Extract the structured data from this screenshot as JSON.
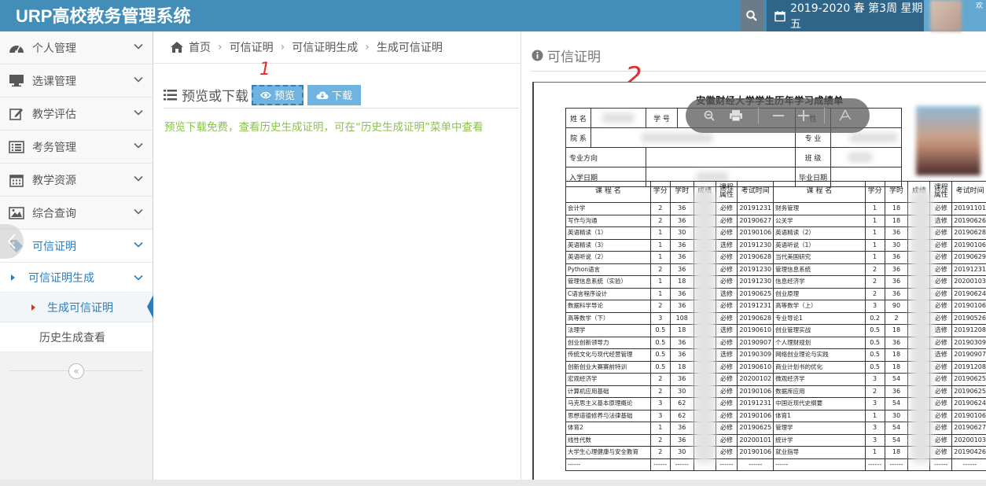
{
  "app": {
    "title": "URP高校教务管理系统",
    "term": "2019-2020 春 第3周 星期五",
    "user_tag": "欢"
  },
  "sidebar": {
    "items": [
      {
        "label": "个人管理",
        "icon": "dashboard-icon"
      },
      {
        "label": "选课管理",
        "icon": "desktop-icon"
      },
      {
        "label": "教学评估",
        "icon": "edit-icon"
      },
      {
        "label": "考务管理",
        "icon": "list-icon"
      },
      {
        "label": "教学资源",
        "icon": "calendar-icon"
      },
      {
        "label": "综合查询",
        "icon": "picture-icon"
      },
      {
        "label": "可信证明",
        "icon": "tag-icon"
      }
    ],
    "sub": {
      "group": "可信证明生成",
      "active": "生成可信证明",
      "history": "历史生成查看"
    }
  },
  "breadcrumb": [
    "首页",
    "可信证明",
    "可信证明生成",
    "生成可信证明"
  ],
  "left_pane": {
    "title": "预览或下载",
    "preview_label": "预览",
    "download_label": "下载",
    "notice": "预览下载免费，查看历史生成证明，可在“历史生成证明”菜单中查看",
    "annotation": "1"
  },
  "right_pane": {
    "heading": "可信证明",
    "annotation": "2"
  },
  "document": {
    "title": "安徽财经大学学生历年学习成绩单",
    "info": {
      "name": "姓 名",
      "student_no": "学 号",
      "college": "院 系",
      "major": "专 业",
      "direction": "专业方向",
      "class": "班 级",
      "enroll": "入学日期",
      "graduate": "毕业日期",
      "gender": "性"
    },
    "headers": [
      "课 程 名",
      "学分",
      "学时",
      "成绩",
      "课程属性",
      "考试时间",
      "课 程 名",
      "学分",
      "学时",
      "成绩",
      "课程属性",
      "考试时间"
    ],
    "rows": [
      [
        "会计学",
        "2",
        "36",
        "必修",
        "20191231",
        "财务管理",
        "1",
        "18",
        "必修",
        "20191101"
      ],
      [
        "写作与沟通",
        "2",
        "36",
        "必修",
        "20190627",
        "公关学",
        "1",
        "18",
        "选修",
        "20190626"
      ],
      [
        "英语精读（1）",
        "1",
        "30",
        "必修",
        "20190106",
        "英语精读（2）",
        "1",
        "36",
        "必修",
        "20190628"
      ],
      [
        "英语精读（3）",
        "1",
        "36",
        "选修",
        "20191230",
        "英语听说（1）",
        "1",
        "30",
        "必修",
        "20190106"
      ],
      [
        "英语听说（2）",
        "1",
        "36",
        "必修",
        "20190628",
        "当代美国研究",
        "1",
        "36",
        "必修",
        "20190629"
      ],
      [
        "Python语言",
        "2",
        "36",
        "必修",
        "20191230",
        "管理信息系统",
        "2",
        "36",
        "必修",
        "20191231"
      ],
      [
        "管理信息系统（实验）",
        "1",
        "18",
        "必修",
        "20191230",
        "信息经济学",
        "2",
        "36",
        "必修",
        "20200103"
      ],
      [
        "C语言程序设计",
        "1",
        "36",
        "选修",
        "20190625",
        "创业原理",
        "2",
        "36",
        "必修",
        "20190624"
      ],
      [
        "数据科学导论",
        "2",
        "36",
        "必修",
        "20191231",
        "高等数学（上）",
        "3",
        "90",
        "必修",
        "20190106"
      ],
      [
        "高等数学（下）",
        "3",
        "108",
        "必修",
        "20190628",
        "专业导论1",
        "0.2",
        "2",
        "必修",
        "20190526"
      ],
      [
        "法理学",
        "0.5",
        "18",
        "选修",
        "20190610",
        "创业管理实战",
        "0.5",
        "18",
        "选修",
        "20191208"
      ],
      [
        "创业创新领导力",
        "0.5",
        "36",
        "必修",
        "20190907",
        "个人理财规划",
        "0.5",
        "36",
        "必修",
        "20190309"
      ],
      [
        "传统文化与现代经营管理",
        "0.5",
        "36",
        "选修",
        "20190309",
        "网络创业理论与实践",
        "0.5",
        "18",
        "选修",
        "20190907"
      ],
      [
        "创新创业大赛赛前特训",
        "0.5",
        "18",
        "必修",
        "20190610",
        "商业计划书的优化",
        "0.5",
        "18",
        "必修",
        "20191208"
      ],
      [
        "宏观经济学",
        "2",
        "36",
        "必修",
        "20200102",
        "微观经济学",
        "3",
        "54",
        "必修",
        "20190625"
      ],
      [
        "计算机应用基础",
        "2",
        "30",
        "必修",
        "20190106",
        "数据库应用",
        "2",
        "36",
        "必修",
        "20190625"
      ],
      [
        "马克思主义基本原理概论",
        "3",
        "62",
        "必修",
        "20191231",
        "中国近现代史纲要",
        "3",
        "54",
        "必修",
        "20190624"
      ],
      [
        "思想道德修养与法律基础",
        "3",
        "62",
        "必修",
        "20190106",
        "体育1",
        "1",
        "30",
        "必修",
        "20190106"
      ],
      [
        "体育2",
        "1",
        "36",
        "必修",
        "20190625",
        "管理学",
        "3",
        "54",
        "必修",
        "20190627"
      ],
      [
        "线性代数",
        "2",
        "36",
        "必修",
        "20200101",
        "统计学",
        "3",
        "54",
        "必修",
        "20200103"
      ],
      [
        "大学生心理健康与安全教育",
        "2",
        "30",
        "必修",
        "20190106",
        "就业指导",
        "1",
        "18",
        "必修",
        "20190426"
      ],
      [
        "------",
        "------",
        "------",
        "------",
        "------",
        "------",
        "------",
        "------",
        "------",
        "------"
      ]
    ]
  },
  "colors": {
    "brand": "#438eb9",
    "term_bg": "#2e6589",
    "button": "#6fb3e0",
    "notice": "#8bc34a",
    "active": "#2b7dbc",
    "annotation": "#e03030"
  }
}
